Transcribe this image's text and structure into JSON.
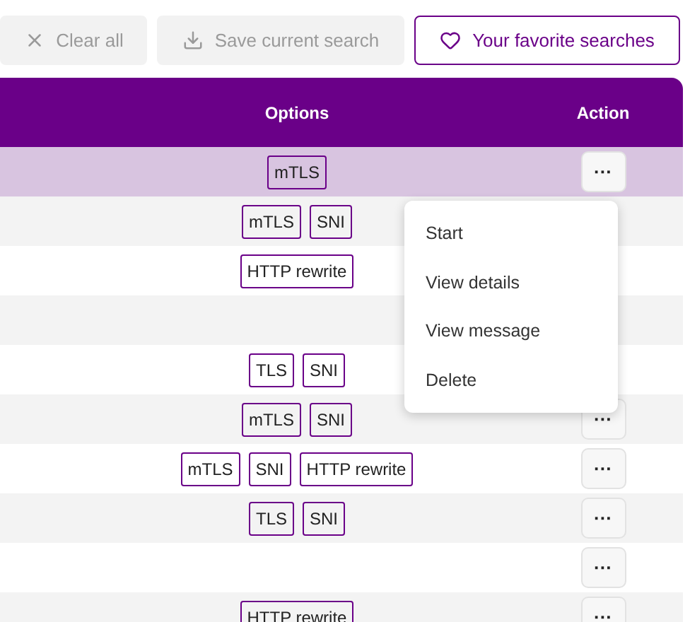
{
  "toolbar": [
    {
      "kind": "clear",
      "label": "Clear all",
      "disabled": true
    },
    {
      "kind": "save",
      "label": "Save current search",
      "disabled": true
    },
    {
      "kind": "favorite",
      "label": "Your favorite searches",
      "disabled": false
    }
  ],
  "table": {
    "columns": [
      "Options",
      "Action"
    ],
    "rows": [
      {
        "selected": true,
        "options": [
          "mTLS"
        ],
        "action": "···"
      },
      {
        "selected": false,
        "options": [
          "mTLS",
          "SNI"
        ]
      },
      {
        "selected": false,
        "options": [
          "HTTP rewrite"
        ]
      },
      {
        "selected": false,
        "options": []
      },
      {
        "selected": false,
        "options": [
          "TLS",
          "SNI"
        ]
      },
      {
        "selected": false,
        "options": [
          "mTLS",
          "SNI"
        ],
        "action": "···"
      },
      {
        "selected": false,
        "options": [
          "mTLS",
          "SNI",
          "HTTP rewrite"
        ],
        "action": "···"
      },
      {
        "selected": false,
        "options": [
          "TLS",
          "SNI"
        ],
        "action": "···"
      },
      {
        "selected": false,
        "options": [],
        "action": "···"
      },
      {
        "selected": false,
        "options": [
          "HTTP rewrite"
        ],
        "action": "···"
      }
    ]
  },
  "menu": {
    "items": [
      "Start",
      "View details",
      "View message",
      "Delete"
    ]
  }
}
